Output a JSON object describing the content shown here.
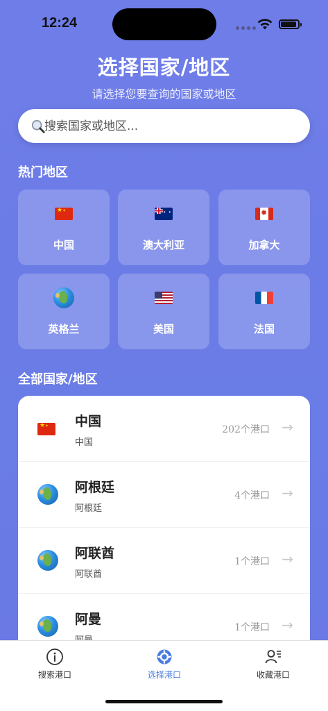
{
  "status_bar": {
    "time": "12:24"
  },
  "header": {
    "title": "选择国家/地区",
    "subtitle": "请选择您要查询的国家或地区"
  },
  "search": {
    "placeholder": "搜索国家或地区..."
  },
  "hot_section": {
    "title": "热门地区",
    "items": [
      {
        "label": "中国",
        "flag": "flag-cn"
      },
      {
        "label": "澳大利亚",
        "flag": "flag-au"
      },
      {
        "label": "加拿大",
        "flag": "flag-ca"
      },
      {
        "label": "英格兰",
        "flag": "globe-icon"
      },
      {
        "label": "美国",
        "flag": "flag-us"
      },
      {
        "label": "法国",
        "flag": "flag-fr"
      }
    ]
  },
  "all_section": {
    "title": "全部国家/地区",
    "rows": [
      {
        "name": "中国",
        "sub": "中国",
        "count": "202个港口",
        "arrow": "→",
        "flag": "flag-cn"
      },
      {
        "name": "阿根廷",
        "sub": "阿根廷",
        "count": "4个港口",
        "arrow": "→",
        "flag": "globe-icon"
      },
      {
        "name": "阿联酋",
        "sub": "阿联酋",
        "count": "1个港口",
        "arrow": "→",
        "flag": "globe-icon"
      },
      {
        "name": "阿曼",
        "sub": "阿曼",
        "count": "1个港口",
        "arrow": "→",
        "flag": "globe-icon"
      }
    ]
  },
  "tab_bar": {
    "tabs": [
      {
        "label": "搜索港口",
        "icon": "info-circle-icon"
      },
      {
        "label": "选择港口",
        "icon": "gear-icon",
        "active": true
      },
      {
        "label": "收藏港口",
        "icon": "user-list-icon"
      }
    ],
    "active_color": "#4a7de0"
  },
  "theme": {
    "background": "#6a7ce6",
    "card": "#ffffff"
  }
}
